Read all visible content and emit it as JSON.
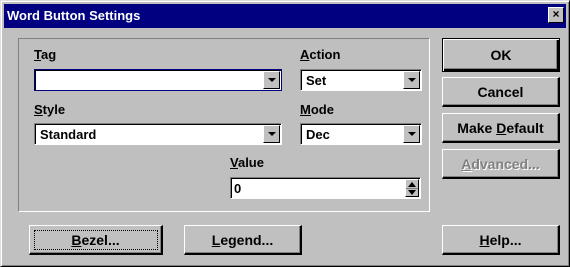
{
  "window": {
    "title": "Word Button Settings",
    "close_glyph": "×"
  },
  "fields": {
    "tag": {
      "label_key": "T",
      "label_rest": "ag",
      "value": ""
    },
    "action": {
      "label_key": "A",
      "label_rest": "ction",
      "value": "Set"
    },
    "style": {
      "label_key": "S",
      "label_rest": "tyle",
      "value": "Standard"
    },
    "mode": {
      "label_key": "M",
      "label_rest": "ode",
      "value": "Dec"
    },
    "value": {
      "label_key": "V",
      "label_rest": "alue",
      "value": "0"
    }
  },
  "buttons": {
    "ok": "OK",
    "cancel": "Cancel",
    "make_default_pre": "Make ",
    "make_default_key": "D",
    "make_default_rest": "efault",
    "advanced_key": "A",
    "advanced_rest": "dvanced...",
    "bezel_key": "B",
    "bezel_rest": "ezel...",
    "legend_key": "L",
    "legend_rest": "egend...",
    "help_key": "H",
    "help_rest": "elp..."
  },
  "icons": {
    "dropdown": "chevron-down-icon",
    "spinner": "up-down-arrows-icon",
    "close": "close-icon"
  },
  "colors": {
    "titlebar": "#000080",
    "face": "#c0c0c0",
    "focus_border": "#000080"
  }
}
